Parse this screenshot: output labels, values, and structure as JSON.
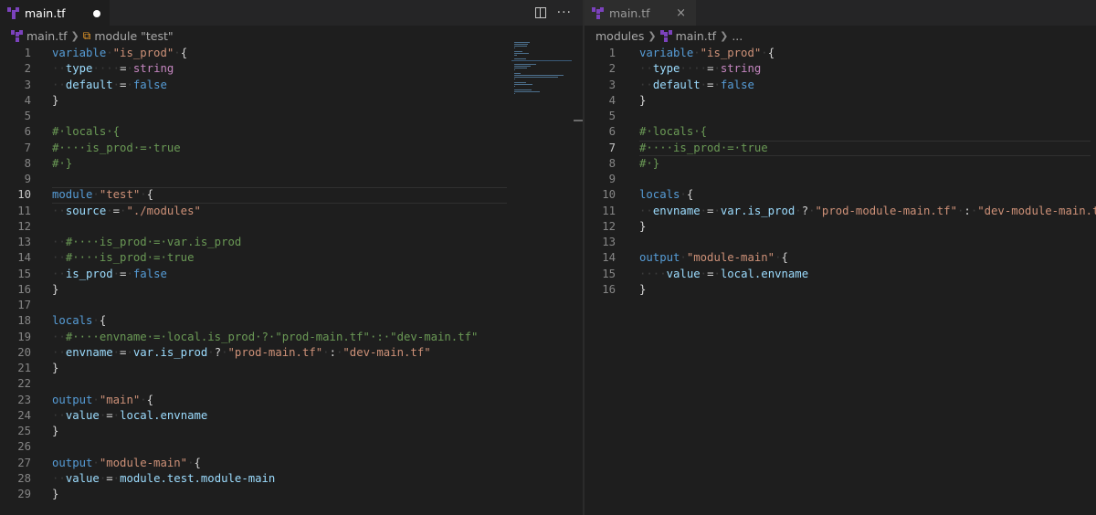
{
  "left_editor": {
    "tab": {
      "filename": "main.tf",
      "dirty": true
    },
    "breadcrumb": [
      "main.tf",
      "module \"test\""
    ],
    "current_line": 10,
    "lines": [
      {
        "n": "1",
        "tokens": [
          [
            "kw",
            "variable"
          ],
          [
            "ws",
            "·"
          ],
          [
            "str",
            "\"is_prod\""
          ],
          [
            "ws",
            "·"
          ],
          [
            "pl",
            "{"
          ]
        ]
      },
      {
        "n": "2",
        "tokens": [
          [
            "ws",
            "··"
          ],
          [
            "prop",
            "type"
          ],
          [
            "ws",
            "····"
          ],
          [
            "op",
            "="
          ],
          [
            "ws",
            "·"
          ],
          [
            "typ",
            "string"
          ]
        ]
      },
      {
        "n": "3",
        "tokens": [
          [
            "ws",
            "··"
          ],
          [
            "prop",
            "default"
          ],
          [
            "ws",
            "·"
          ],
          [
            "op",
            "="
          ],
          [
            "ws",
            "·"
          ],
          [
            "bool",
            "false"
          ]
        ]
      },
      {
        "n": "4",
        "tokens": [
          [
            "pl",
            "}"
          ]
        ]
      },
      {
        "n": "5",
        "tokens": []
      },
      {
        "n": "6",
        "tokens": [
          [
            "cm",
            "#·locals·{"
          ]
        ]
      },
      {
        "n": "7",
        "tokens": [
          [
            "cm",
            "#····is_prod·=·true"
          ]
        ]
      },
      {
        "n": "8",
        "tokens": [
          [
            "cm",
            "#·}"
          ]
        ]
      },
      {
        "n": "9",
        "tokens": []
      },
      {
        "n": "10",
        "tokens": [
          [
            "kw",
            "module"
          ],
          [
            "ws",
            "·"
          ],
          [
            "str",
            "\"test\""
          ],
          [
            "ws",
            "·"
          ],
          [
            "pl",
            "{"
          ]
        ]
      },
      {
        "n": "11",
        "tokens": [
          [
            "ws",
            "··"
          ],
          [
            "prop",
            "source"
          ],
          [
            "ws",
            "·"
          ],
          [
            "op",
            "="
          ],
          [
            "ws",
            "·"
          ],
          [
            "str",
            "\"./modules\""
          ]
        ]
      },
      {
        "n": "12",
        "tokens": []
      },
      {
        "n": "13",
        "tokens": [
          [
            "ws",
            "··"
          ],
          [
            "cm",
            "#····is_prod·=·var.is_prod"
          ]
        ]
      },
      {
        "n": "14",
        "tokens": [
          [
            "ws",
            "··"
          ],
          [
            "cm",
            "#····is_prod·=·true"
          ]
        ]
      },
      {
        "n": "15",
        "tokens": [
          [
            "ws",
            "··"
          ],
          [
            "prop",
            "is_prod"
          ],
          [
            "ws",
            "·"
          ],
          [
            "op",
            "="
          ],
          [
            "ws",
            "·"
          ],
          [
            "bool",
            "false"
          ]
        ]
      },
      {
        "n": "16",
        "tokens": [
          [
            "pl",
            "}"
          ]
        ]
      },
      {
        "n": "17",
        "tokens": []
      },
      {
        "n": "18",
        "tokens": [
          [
            "kw",
            "locals"
          ],
          [
            "ws",
            "·"
          ],
          [
            "pl",
            "{"
          ]
        ]
      },
      {
        "n": "19",
        "tokens": [
          [
            "ws",
            "··"
          ],
          [
            "cm",
            "#····envname·=·local.is_prod·?·\"prod-main.tf\"·:·\"dev-main.tf\""
          ]
        ]
      },
      {
        "n": "20",
        "tokens": [
          [
            "ws",
            "··"
          ],
          [
            "prop",
            "envname"
          ],
          [
            "ws",
            "·"
          ],
          [
            "op",
            "="
          ],
          [
            "ws",
            "·"
          ],
          [
            "prop",
            "var.is_prod"
          ],
          [
            "ws",
            "·"
          ],
          [
            "op",
            "?"
          ],
          [
            "ws",
            "·"
          ],
          [
            "str",
            "\"prod-main.tf\""
          ],
          [
            "ws",
            "·"
          ],
          [
            "op",
            ":"
          ],
          [
            "ws",
            "·"
          ],
          [
            "str",
            "\"dev-main.tf\""
          ]
        ]
      },
      {
        "n": "21",
        "tokens": [
          [
            "pl",
            "}"
          ]
        ]
      },
      {
        "n": "22",
        "tokens": []
      },
      {
        "n": "23",
        "tokens": [
          [
            "kw",
            "output"
          ],
          [
            "ws",
            "·"
          ],
          [
            "str",
            "\"main\""
          ],
          [
            "ws",
            "·"
          ],
          [
            "pl",
            "{"
          ]
        ]
      },
      {
        "n": "24",
        "tokens": [
          [
            "ws",
            "··"
          ],
          [
            "prop",
            "value"
          ],
          [
            "ws",
            "·"
          ],
          [
            "op",
            "="
          ],
          [
            "ws",
            "·"
          ],
          [
            "prop",
            "local.envname"
          ]
        ]
      },
      {
        "n": "25",
        "tokens": [
          [
            "pl",
            "}"
          ]
        ]
      },
      {
        "n": "26",
        "tokens": []
      },
      {
        "n": "27",
        "tokens": [
          [
            "kw",
            "output"
          ],
          [
            "ws",
            "·"
          ],
          [
            "str",
            "\"module-main\""
          ],
          [
            "ws",
            "·"
          ],
          [
            "pl",
            "{"
          ]
        ]
      },
      {
        "n": "28",
        "tokens": [
          [
            "ws",
            "··"
          ],
          [
            "prop",
            "value"
          ],
          [
            "ws",
            "·"
          ],
          [
            "op",
            "="
          ],
          [
            "ws",
            "·"
          ],
          [
            "prop",
            "module.test.module-main"
          ]
        ]
      },
      {
        "n": "29",
        "tokens": [
          [
            "pl",
            "}"
          ]
        ]
      }
    ]
  },
  "right_editor": {
    "tab": {
      "filename": "main.tf",
      "close_label": "×"
    },
    "breadcrumb": [
      "modules",
      "main.tf",
      "..."
    ],
    "current_line": 7,
    "lines": [
      {
        "n": "1",
        "tokens": [
          [
            "kw",
            "variable"
          ],
          [
            "ws",
            "·"
          ],
          [
            "str",
            "\"is_prod\""
          ],
          [
            "ws",
            "·"
          ],
          [
            "pl",
            "{"
          ]
        ]
      },
      {
        "n": "2",
        "tokens": [
          [
            "ws",
            "··"
          ],
          [
            "prop",
            "type"
          ],
          [
            "ws",
            "····"
          ],
          [
            "op",
            "="
          ],
          [
            "ws",
            "·"
          ],
          [
            "typ",
            "string"
          ]
        ]
      },
      {
        "n": "3",
        "tokens": [
          [
            "ws",
            "··"
          ],
          [
            "prop",
            "default"
          ],
          [
            "ws",
            "·"
          ],
          [
            "op",
            "="
          ],
          [
            "ws",
            "·"
          ],
          [
            "bool",
            "false"
          ]
        ]
      },
      {
        "n": "4",
        "tokens": [
          [
            "pl",
            "}"
          ]
        ]
      },
      {
        "n": "5",
        "tokens": []
      },
      {
        "n": "6",
        "tokens": [
          [
            "cm",
            "#·locals·{"
          ]
        ]
      },
      {
        "n": "7",
        "tokens": [
          [
            "cm",
            "#····is_prod·=·true"
          ]
        ]
      },
      {
        "n": "8",
        "tokens": [
          [
            "cm",
            "#·}"
          ]
        ]
      },
      {
        "n": "9",
        "tokens": []
      },
      {
        "n": "10",
        "tokens": [
          [
            "kw",
            "locals"
          ],
          [
            "ws",
            "·"
          ],
          [
            "pl",
            "{"
          ]
        ]
      },
      {
        "n": "11",
        "tokens": [
          [
            "ws",
            "··"
          ],
          [
            "prop",
            "envname"
          ],
          [
            "ws",
            "·"
          ],
          [
            "op",
            "="
          ],
          [
            "ws",
            "·"
          ],
          [
            "prop",
            "var.is_prod"
          ],
          [
            "ws",
            "·"
          ],
          [
            "op",
            "?"
          ],
          [
            "ws",
            "·"
          ],
          [
            "str",
            "\"prod-module-main.tf\""
          ],
          [
            "ws",
            "·"
          ],
          [
            "op",
            ":"
          ],
          [
            "ws",
            "·"
          ],
          [
            "str",
            "\"dev-module-main.tf\""
          ]
        ]
      },
      {
        "n": "12",
        "tokens": [
          [
            "pl",
            "}"
          ]
        ]
      },
      {
        "n": "13",
        "tokens": []
      },
      {
        "n": "14",
        "tokens": [
          [
            "kw",
            "output"
          ],
          [
            "ws",
            "·"
          ],
          [
            "str",
            "\"module-main\""
          ],
          [
            "ws",
            "·"
          ],
          [
            "pl",
            "{"
          ]
        ]
      },
      {
        "n": "15",
        "tokens": [
          [
            "ws",
            "····"
          ],
          [
            "prop",
            "value"
          ],
          [
            "ws",
            "·"
          ],
          [
            "op",
            "="
          ],
          [
            "ws",
            "·"
          ],
          [
            "prop",
            "local.envname"
          ]
        ]
      },
      {
        "n": "16",
        "tokens": [
          [
            "pl",
            "}"
          ]
        ]
      }
    ]
  },
  "actions": {
    "more_label": "···"
  },
  "colors": {
    "keyword": "#569cd6",
    "string": "#ce9178",
    "property": "#9cdcfe",
    "type": "#c586c0",
    "comment": "#6a9955",
    "plain": "#d4d4d4",
    "terraform": "#7b42bc"
  }
}
